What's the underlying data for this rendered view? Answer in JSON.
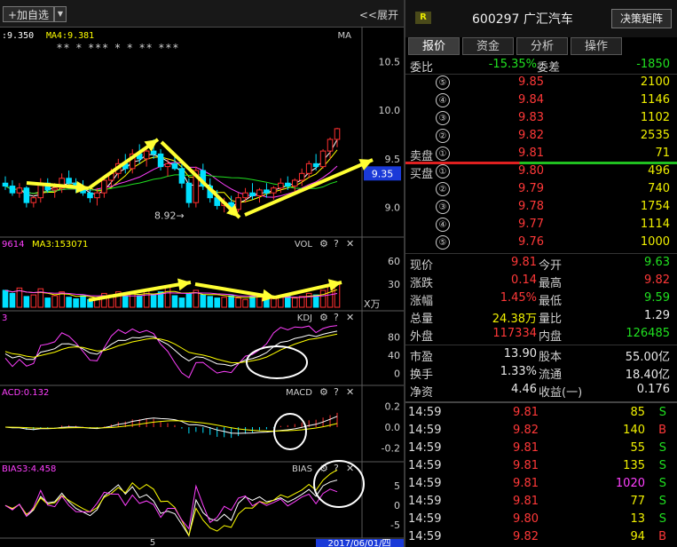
{
  "toolbar": {
    "add_label": "+加自选",
    "expand_label": "<<展开"
  },
  "chart_data": [
    {
      "type": "candlestick",
      "title": "",
      "legend": [
        {
          "name": "MA3",
          "value": "9.350",
          "color": "#ffffff",
          "visible_text": ":9.350"
        },
        {
          "name": "MA4",
          "value": "9.381",
          "color": "#ffff00"
        }
      ],
      "top_right_label": "MA",
      "markers": "** * *** * * ** ***",
      "y_ticks": [
        10.5,
        10.0,
        9.5,
        9.0
      ],
      "ylim": [
        8.75,
        10.75
      ],
      "current_price_tag": "9.35",
      "low_annotation": "8.92",
      "ohlc": [
        [
          9.25,
          9.32,
          9.18,
          9.22
        ],
        [
          9.22,
          9.28,
          9.12,
          9.15
        ],
        [
          9.15,
          9.25,
          9.1,
          9.2
        ],
        [
          9.2,
          9.22,
          9.0,
          9.05
        ],
        [
          9.05,
          9.12,
          9.0,
          9.1
        ],
        [
          9.1,
          9.3,
          9.05,
          9.25
        ],
        [
          9.25,
          9.3,
          9.15,
          9.18
        ],
        [
          9.18,
          9.25,
          9.1,
          9.2
        ],
        [
          9.2,
          9.35,
          9.15,
          9.3
        ],
        [
          9.3,
          9.38,
          9.22,
          9.25
        ],
        [
          9.25,
          9.3,
          9.15,
          9.2
        ],
        [
          9.2,
          9.28,
          9.12,
          9.15
        ],
        [
          9.15,
          9.2,
          9.05,
          9.1
        ],
        [
          9.1,
          9.2,
          9.02,
          9.15
        ],
        [
          9.15,
          9.3,
          9.1,
          9.28
        ],
        [
          9.28,
          9.4,
          9.22,
          9.35
        ],
        [
          9.35,
          9.5,
          9.3,
          9.45
        ],
        [
          9.45,
          9.55,
          9.35,
          9.4
        ],
        [
          9.4,
          9.6,
          9.35,
          9.55
        ],
        [
          9.55,
          9.65,
          9.45,
          9.5
        ],
        [
          9.5,
          9.62,
          9.42,
          9.58
        ],
        [
          9.58,
          9.7,
          9.5,
          9.55
        ],
        [
          9.55,
          9.6,
          9.38,
          9.42
        ],
        [
          9.42,
          9.5,
          9.32,
          9.45
        ],
        [
          9.45,
          9.55,
          9.38,
          9.4
        ],
        [
          9.4,
          9.45,
          9.2,
          9.25
        ],
        [
          9.25,
          9.3,
          9.0,
          9.05
        ],
        [
          9.05,
          9.42,
          9.0,
          9.38
        ],
        [
          9.38,
          9.45,
          9.18,
          9.22
        ],
        [
          9.22,
          9.3,
          9.05,
          9.1
        ],
        [
          9.1,
          9.18,
          8.98,
          9.02
        ],
        [
          9.02,
          9.1,
          8.95,
          9.05
        ],
        [
          9.05,
          9.12,
          8.92,
          8.98
        ],
        [
          8.98,
          9.15,
          8.95,
          9.1
        ],
        [
          9.1,
          9.2,
          9.05,
          9.15
        ],
        [
          9.15,
          9.25,
          9.08,
          9.12
        ],
        [
          9.12,
          9.2,
          9.05,
          9.18
        ],
        [
          9.18,
          9.25,
          9.1,
          9.15
        ],
        [
          9.15,
          9.22,
          9.08,
          9.2
        ],
        [
          9.2,
          9.3,
          9.15,
          9.25
        ],
        [
          9.25,
          9.32,
          9.18,
          9.22
        ],
        [
          9.22,
          9.3,
          9.15,
          9.28
        ],
        [
          9.28,
          9.4,
          9.22,
          9.35
        ],
        [
          9.35,
          9.48,
          9.3,
          9.45
        ],
        [
          9.45,
          9.55,
          9.38,
          9.42
        ],
        [
          9.42,
          9.6,
          9.4,
          9.58
        ],
        [
          9.58,
          9.72,
          9.5,
          9.7
        ],
        [
          9.7,
          9.82,
          9.62,
          9.81
        ]
      ]
    },
    {
      "type": "bar",
      "title": "VOL",
      "legend": [
        {
          "name": "VOL",
          "value": "9614",
          "color": "#ff40ff",
          "visible_text": "9614"
        },
        {
          "name": "MA3",
          "value": "153071",
          "color": "#ffff00"
        }
      ],
      "y_ticks": [
        60,
        30
      ],
      "unit": "X万",
      "ylim": [
        0,
        75
      ],
      "values": [
        22,
        18,
        25,
        14,
        16,
        24,
        12,
        15,
        20,
        13,
        11,
        15,
        10,
        12,
        18,
        16,
        20,
        14,
        18,
        15,
        22,
        17,
        20,
        28,
        15,
        12,
        18,
        22,
        16,
        14,
        12,
        13,
        15,
        12,
        10,
        14,
        16,
        12,
        11,
        13,
        15,
        12,
        14,
        18,
        16,
        22,
        28,
        30
      ]
    },
    {
      "type": "line",
      "title": "KDJ",
      "legend_text": "3",
      "y_ticks": [
        80,
        40,
        0
      ],
      "ylim": [
        -15,
        110
      ]
    },
    {
      "type": "line",
      "title": "MACD",
      "legend_text": "ACD:0.132",
      "y_ticks": [
        0.2,
        0.0,
        -0.2
      ],
      "ylim": [
        -0.28,
        0.28
      ]
    },
    {
      "type": "line",
      "title": "BIAS",
      "legend_text": "BIAS3:4.458",
      "y_ticks": [
        5,
        0,
        -5
      ],
      "ylim": [
        -7,
        8
      ]
    }
  ],
  "x_axis": {
    "label": "5",
    "date_label": "2017/06/01/四"
  },
  "quote": {
    "badge": "R",
    "code": "600297",
    "name": "广汇汽车",
    "matrix_button": "决策矩阵",
    "tabs": [
      "报价",
      "资金",
      "分析",
      "操作"
    ],
    "weibi_label": "委比",
    "weibi_value": "-15.35%",
    "weicha_label": "委差",
    "weicha_value": "-1850",
    "sell_label": "卖盘",
    "buy_label": "买盘",
    "sells": [
      {
        "level": "⑤",
        "price": "9.85",
        "vol": "2100"
      },
      {
        "level": "④",
        "price": "9.84",
        "vol": "1146"
      },
      {
        "level": "③",
        "price": "9.83",
        "vol": "1102"
      },
      {
        "level": "②",
        "price": "9.82",
        "vol": "2535"
      },
      {
        "level": "①",
        "price": "9.81",
        "vol": "71"
      }
    ],
    "buys": [
      {
        "level": "①",
        "price": "9.80",
        "vol": "496"
      },
      {
        "level": "②",
        "price": "9.79",
        "vol": "740"
      },
      {
        "level": "③",
        "price": "9.78",
        "vol": "1754"
      },
      {
        "level": "④",
        "price": "9.77",
        "vol": "1114"
      },
      {
        "level": "⑤",
        "price": "9.76",
        "vol": "1000"
      }
    ],
    "stats": [
      {
        "l1": "现价",
        "v1": "9.81",
        "c1": "red",
        "l2": "今开",
        "v2": "9.63",
        "c2": "green"
      },
      {
        "l1": "涨跌",
        "v1": "0.14",
        "c1": "red",
        "l2": "最高",
        "v2": "9.82",
        "c2": "red"
      },
      {
        "l1": "涨幅",
        "v1": "1.45%",
        "c1": "red",
        "l2": "最低",
        "v2": "9.59",
        "c2": "green"
      },
      {
        "l1": "总量",
        "v1": "24.38万",
        "c1": "yellow",
        "l2": "量比",
        "v2": "1.29",
        "c2": "white"
      },
      {
        "l1": "外盘",
        "v1": "117334",
        "c1": "red",
        "l2": "内盘",
        "v2": "126485",
        "c2": "green"
      }
    ],
    "stats2": [
      {
        "l1": "市盈",
        "v1": "13.90",
        "l2": "股本",
        "v2": "55.00亿"
      },
      {
        "l1": "换手",
        "v1": "1.33%",
        "l2": "流通",
        "v2": "18.40亿"
      },
      {
        "l1": "净资",
        "v1": "4.46",
        "l2": "收益(一)",
        "v2": "0.176"
      }
    ],
    "ticks": [
      {
        "time": "14:59",
        "price": "9.81",
        "vol": "85",
        "dir": "S"
      },
      {
        "time": "14:59",
        "price": "9.82",
        "vol": "140",
        "dir": "B"
      },
      {
        "time": "14:59",
        "price": "9.81",
        "vol": "55",
        "dir": "S"
      },
      {
        "time": "14:59",
        "price": "9.81",
        "vol": "135",
        "dir": "S"
      },
      {
        "time": "14:59",
        "price": "9.81",
        "vol": "1020",
        "dir": "S"
      },
      {
        "time": "14:59",
        "price": "9.81",
        "vol": "77",
        "dir": "S"
      },
      {
        "time": "14:59",
        "price": "9.80",
        "vol": "13",
        "dir": "S"
      },
      {
        "time": "14:59",
        "price": "9.82",
        "vol": "94",
        "dir": "B"
      }
    ]
  },
  "colors": {
    "up": "#ff3030",
    "down": "#00e0ff",
    "ma_white": "#ffffff",
    "ma_yellow": "#ffff00",
    "ma_magenta": "#ff40ff",
    "ma_green": "#20e020",
    "annotation": "#ffff33"
  }
}
